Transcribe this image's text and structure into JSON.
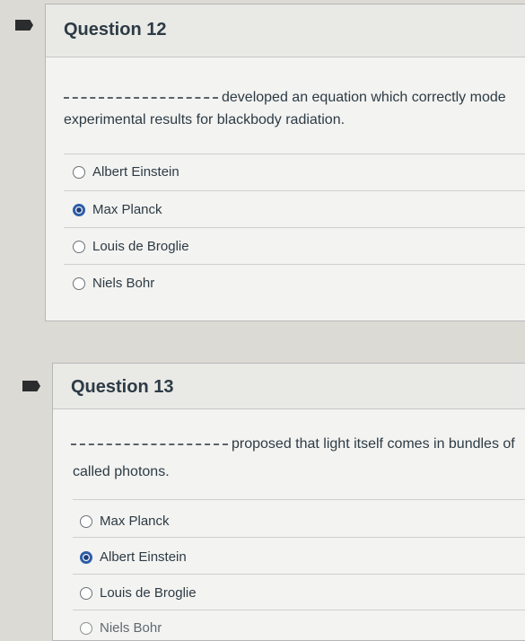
{
  "q12": {
    "title": "Question 12",
    "blank": "____________________",
    "prompt_line1": "developed an equation which correctly mode",
    "prompt_line2": "experimental results for blackbody radiation.",
    "answers": [
      {
        "label": "Albert Einstein",
        "selected": false
      },
      {
        "label": "Max Planck",
        "selected": true
      },
      {
        "label": "Louis de Broglie",
        "selected": false
      },
      {
        "label": "Niels Bohr",
        "selected": false
      }
    ]
  },
  "q13": {
    "title": "Question 13",
    "blank": "____________________",
    "prompt_line1": "proposed that light itself comes in bundles of",
    "prompt_line2": "called photons.",
    "answers": [
      {
        "label": "Max Planck",
        "selected": false
      },
      {
        "label": "Albert Einstein",
        "selected": true
      },
      {
        "label": "Louis de Broglie",
        "selected": false
      },
      {
        "label": "Niels Bohr",
        "selected": false
      }
    ]
  }
}
